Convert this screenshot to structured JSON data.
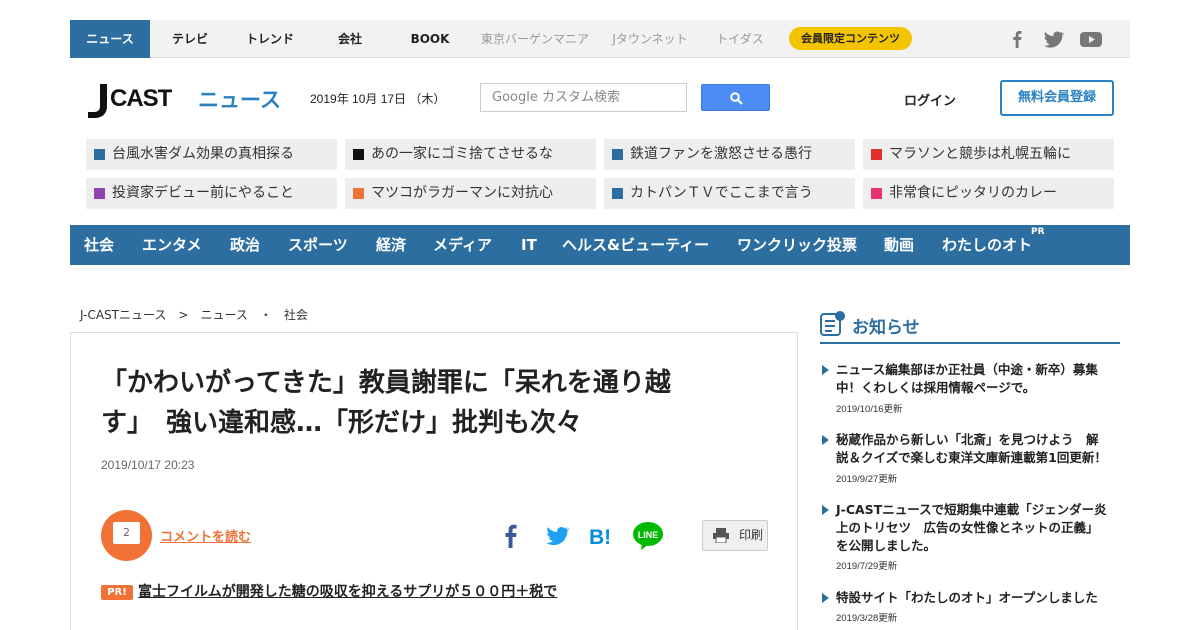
{
  "topnav": {
    "items": [
      {
        "label": "ニュース"
      },
      {
        "label": "テレビ"
      },
      {
        "label": "トレンド"
      },
      {
        "label": "会社"
      },
      {
        "label": "BOOK"
      },
      {
        "label": "東京バーゲンマニア"
      },
      {
        "label": "Jタウンネット"
      },
      {
        "label": "トイダス"
      }
    ],
    "member_label": "会員限定コンテンツ",
    "social_icons": [
      "facebook-icon",
      "twitter-icon",
      "youtube-icon"
    ]
  },
  "header": {
    "logo_text": "J CAST",
    "logo_sub": "ニュース",
    "date": "2019年 10月 17日 （木）",
    "search_placeholder": "Google カスタム検索",
    "login_label": "ログイン",
    "register_label": "無料会員登録"
  },
  "topics": [
    {
      "label": "台風水害ダム効果の真相探る",
      "color": "#2c6e9f"
    },
    {
      "label": "あの一家にゴミ捨てさせるな",
      "color": "#111111"
    },
    {
      "label": "鉄道ファンを激怒させる愚行",
      "color": "#2c6e9f"
    },
    {
      "label": "マラソンと競歩は札幌五輪に",
      "color": "#e0302c"
    },
    {
      "label": "投資家デビュー前にやること",
      "color": "#8e44ad"
    },
    {
      "label": "マツコがラガーマンに対抗心",
      "color": "#f07236"
    },
    {
      "label": "カトパンＴＶでここまで言う",
      "color": "#2c6e9f"
    },
    {
      "label": "非常食にピッタリのカレー",
      "color": "#e8336e"
    }
  ],
  "catnav": {
    "items": [
      {
        "label": "社会"
      },
      {
        "label": "エンタメ"
      },
      {
        "label": "政治"
      },
      {
        "label": "スポーツ"
      },
      {
        "label": "経済"
      },
      {
        "label": "メディア"
      },
      {
        "label": "IT"
      },
      {
        "label": "ヘルス&ビューティー"
      },
      {
        "label": "ワンクリック投票"
      },
      {
        "label": "動画"
      },
      {
        "label": "わたしのオト"
      }
    ],
    "pr_label": "PR"
  },
  "breadcrumb": {
    "items": [
      "J-CASTニュース",
      ">",
      "ニュース",
      "・",
      "社会"
    ]
  },
  "article": {
    "title_line1": "「かわいがってきた」教員謝罪に「呆れを通り越",
    "title_line2": "す」　強い違和感…「形だけ」批判も次々",
    "date": "2019/10/17 20:23",
    "comment_count": "2",
    "comment_link": "コメントを読む",
    "share_icons": [
      "facebook-icon",
      "twitter-icon",
      "hatena-bookmark-icon",
      "line-icon"
    ],
    "hatena_label": "B!",
    "line_label": "LINE",
    "print_label": "印刷",
    "pr_badge": "PR!",
    "pr_link": "富士フイルムが開発した糖の吸収を抑えるサプリが５００円＋税で"
  },
  "sidebar": {
    "heading": "お知らせ",
    "notices": [
      {
        "line1": "ニュース編集部ほか正社員（中途・新卒）募集",
        "line2": "中！くわしくは採用情報ページで。",
        "line3": "",
        "updated": "2019/10/16更新"
      },
      {
        "line1": "秘蔵作品から新しい「北斎」を見つけよう　解",
        "line2": "説＆クイズで楽しむ東洋文庫新連載第1回更新！",
        "line3": "",
        "updated": "2019/9/27更新"
      },
      {
        "line1": "J-CASTニュースで短期集中連載「ジェンダー炎",
        "line2": "上のトリセツ　広告の女性像とネットの正義」",
        "line3": "を公開しました。",
        "updated": "2019/7/29更新"
      },
      {
        "line1": "特設サイト「わたしのオト」オープンしました",
        "line2": "",
        "line3": "",
        "updated": "2019/3/28更新"
      }
    ]
  },
  "colors": {
    "primary": "#2c6e9f",
    "accent": "#f07236",
    "member": "#f5c400"
  }
}
